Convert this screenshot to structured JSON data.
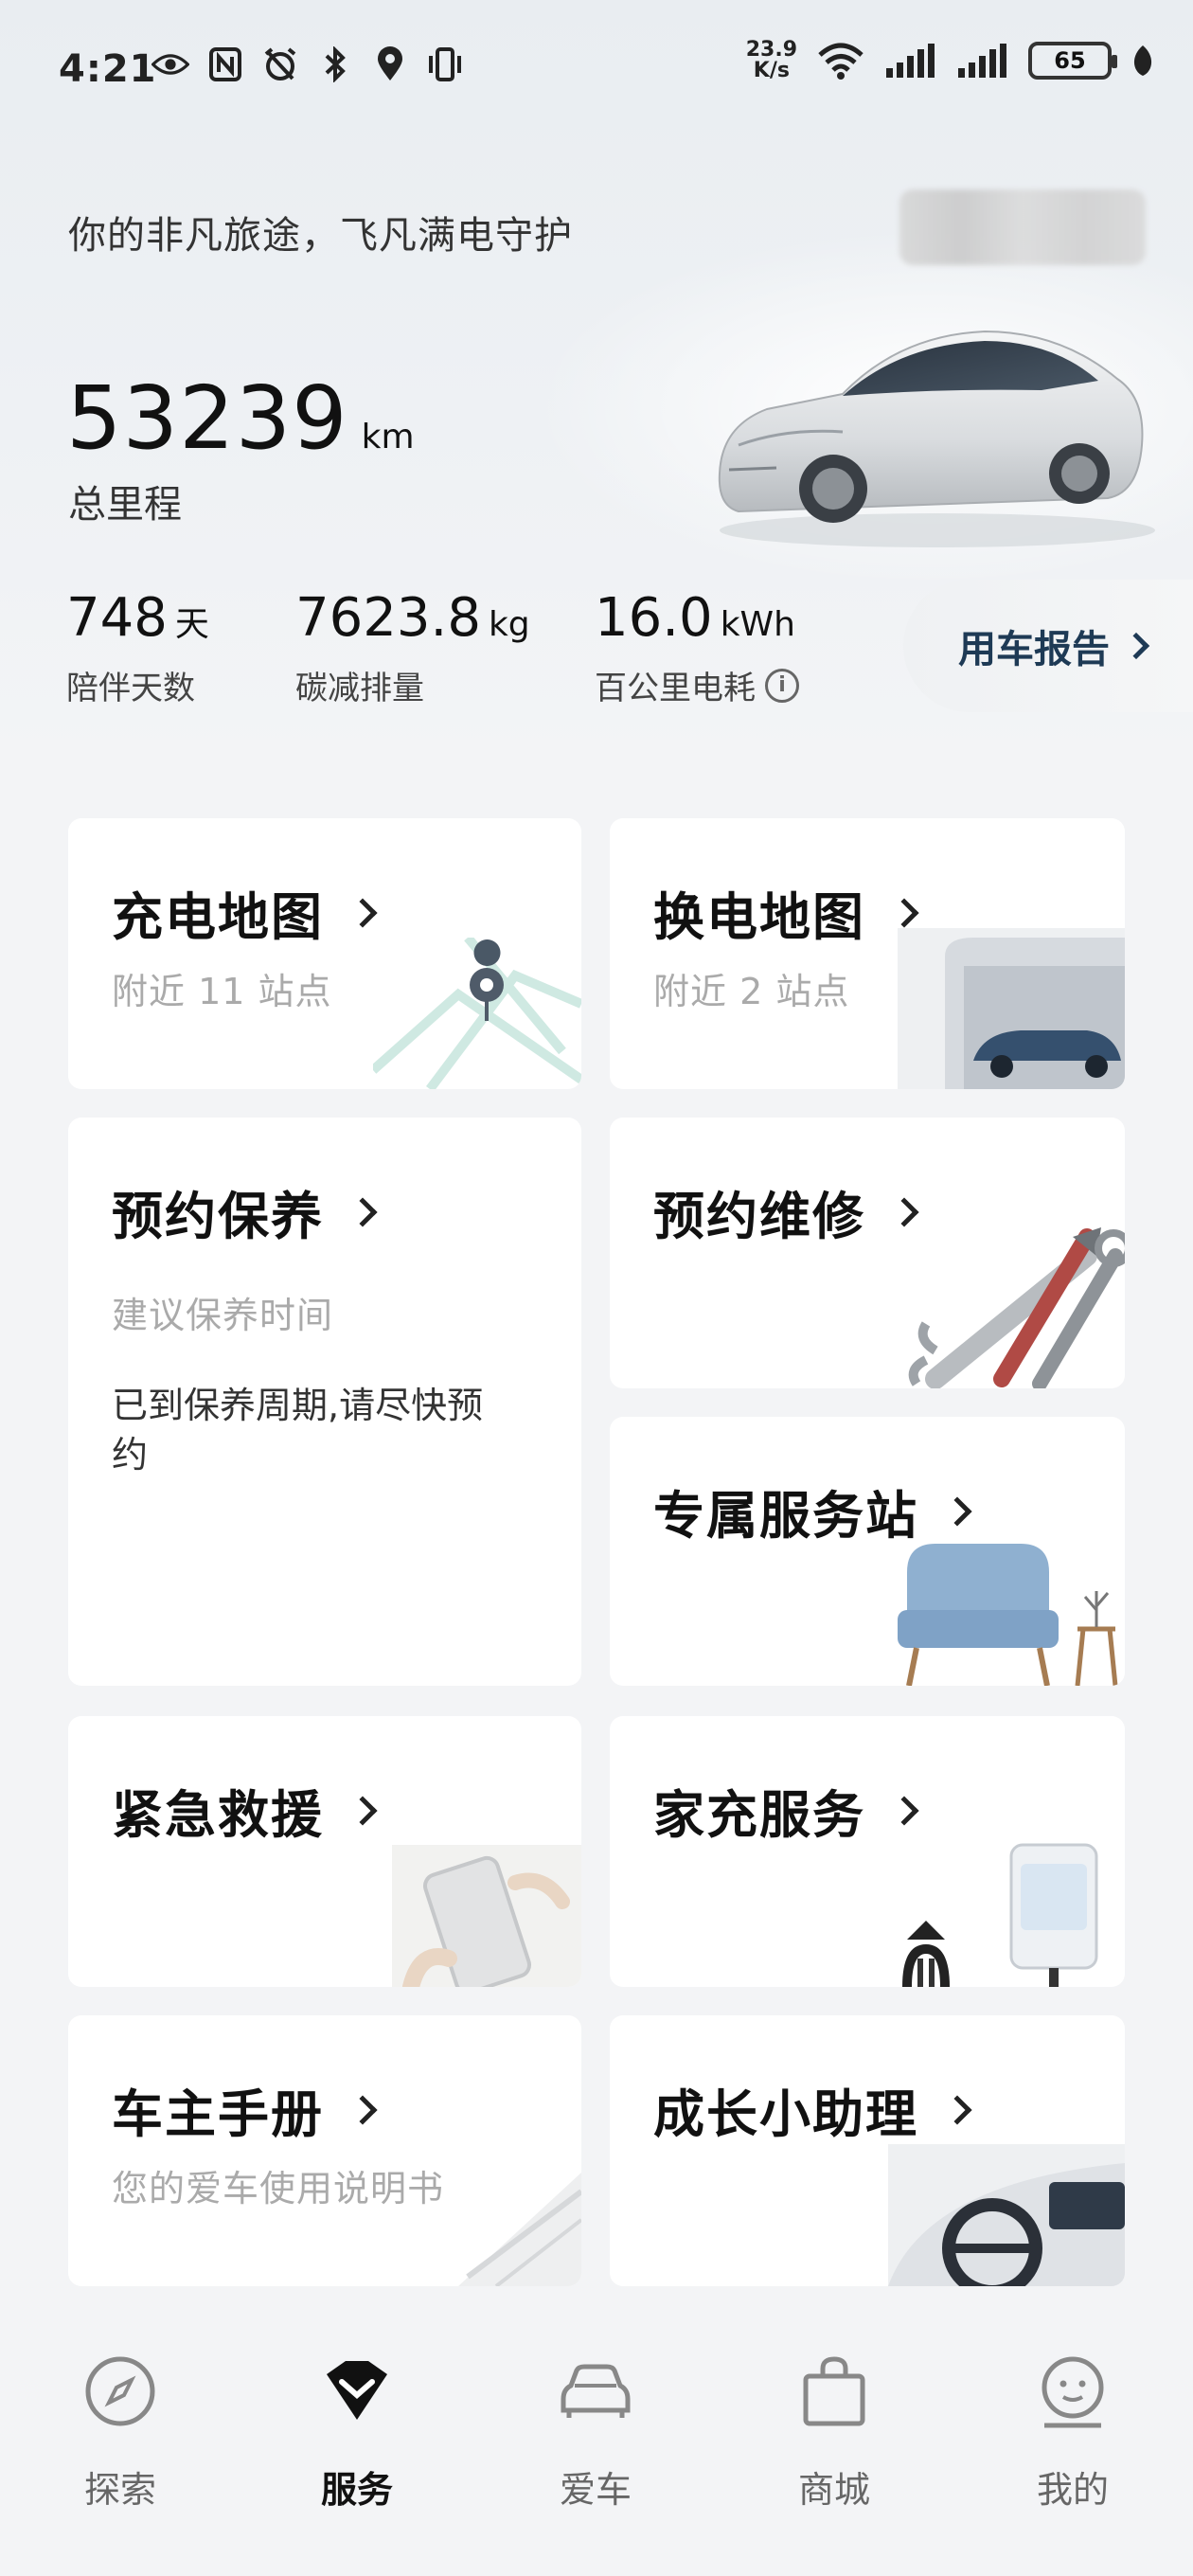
{
  "status_bar": {
    "time": "4:21",
    "net_speed_value": "23.9",
    "net_speed_unit": "K/s",
    "battery": "65"
  },
  "hero": {
    "slogan": "你的非凡旅途，飞凡满电守护",
    "mileage_value": "53239",
    "mileage_unit": "km",
    "mileage_label": "总里程"
  },
  "stats": [
    {
      "value": "748",
      "unit": "天",
      "label": "陪伴天数"
    },
    {
      "value": "7623.8",
      "unit": "kg",
      "label": "碳减排量"
    },
    {
      "value": "16.0",
      "unit": "kWh",
      "label": "百公里电耗"
    }
  ],
  "report_button": {
    "label": "用车报告"
  },
  "cards": {
    "charging_map": {
      "title": "充电地图",
      "subtitle": "附近 11 站点"
    },
    "swap_map": {
      "title": "换电地图",
      "subtitle": "附近 2 站点"
    },
    "maintenance": {
      "title": "预约保养",
      "subtitle": "建议保养时间",
      "body": "已到保养周期,请尽快预约"
    },
    "repair": {
      "title": "预约维修"
    },
    "service_station": {
      "title": "专属服务站"
    },
    "rescue": {
      "title": "紧急救援"
    },
    "home_charging": {
      "title": "家充服务"
    },
    "manual": {
      "title": "车主手册",
      "subtitle": "您的爱车使用说明书"
    },
    "assistant": {
      "title": "成长小助理"
    }
  },
  "bottom_nav": [
    {
      "label": "探索",
      "icon": "compass-icon"
    },
    {
      "label": "服务",
      "icon": "diamond-icon",
      "active": true
    },
    {
      "label": "爱车",
      "icon": "car-icon"
    },
    {
      "label": "商城",
      "icon": "shopping-bag-icon"
    },
    {
      "label": "我的",
      "icon": "profile-face-icon"
    }
  ],
  "colors": {
    "background": "#f3f4f6",
    "card": "#ffffff",
    "report_text": "#1e3a55",
    "muted_text": "#aaaaaa"
  }
}
